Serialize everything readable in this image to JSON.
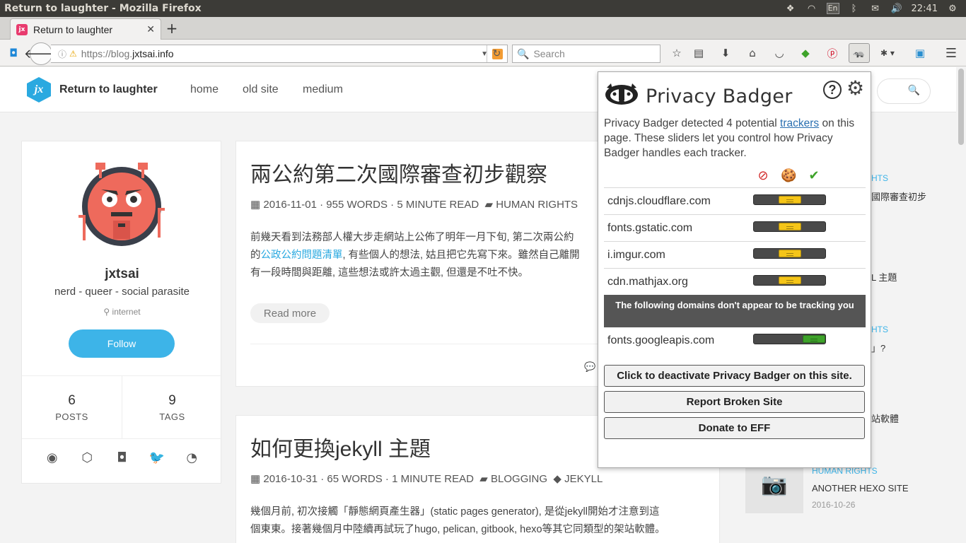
{
  "os": {
    "window_title": "Return to laughter - Mozilla Firefox",
    "input_method": "En",
    "clock": "22:41"
  },
  "browser": {
    "tab_title": "Return to laughter",
    "tab_favicon_text": "jx",
    "url_prefix": "https://blog.",
    "url_domain": "jxtsai.info",
    "search_placeholder": "Search"
  },
  "site": {
    "logo_text": "jx",
    "title": "Return to laughter",
    "nav": [
      "home",
      "old site",
      "medium"
    ]
  },
  "profile": {
    "name": "jxtsai",
    "bio": "nerd - queer - social parasite",
    "location": "internet",
    "follow_label": "Follow",
    "posts_count": "6",
    "posts_label": "POSTS",
    "tags_count": "9",
    "tags_label": "TAGS"
  },
  "posts": [
    {
      "title": "兩公約第二次國際審查初步觀察",
      "meta": "2016-11-01 · 955 WORDS · 5 MINUTE READ",
      "category": "HUMAN RIGHTS",
      "excerpt_1": "前幾天看到法務部人權大步走網站上公佈了明年一月下旬, 第二次兩公約",
      "excerpt_2a": "的",
      "excerpt_link": "公政公約問題清單",
      "excerpt_2b": ", 有些個人的想法, 姑且把它先寫下來。雖然自己離開",
      "excerpt_3": "有一段時間與距離, 這些想法或許太過主觀, 但還是不吐不快。",
      "read_more": "Read more"
    },
    {
      "title": "如何更換jekyll 主題",
      "meta": "2016-10-31 · 65 WORDS · 1 MINUTE READ",
      "category": "BLOGGING",
      "tag": "JEKYLL",
      "excerpt_1": "幾個月前, 初次接觸「靜態網頁產生器」(static pages generator), 是從jekyll開始才注意到這",
      "excerpt_2": "個東東。接著幾個月中陸續再試玩了hugo, pelican, gitbook, hexo等其它同類型的架站軟體。"
    }
  ],
  "sidebar": {
    "frag_cat1": "HTS",
    "frag_title1": "國際審查初步",
    "frag_title2": "L 主題",
    "frag_cat3": "HTS",
    "frag_title3": "」?",
    "frag_title4": "站軟體",
    "last_cat": "HUMAN RIGHTS",
    "last_title": "ANOTHER HEXO SITE",
    "last_date": "2016-10-26"
  },
  "privacy_badger": {
    "title": "Privacy Badger",
    "desc_pre": "Privacy Badger detected 4 potential ",
    "desc_link": "trackers",
    "desc_post": " on this page. These sliders let you control how Privacy Badger handles each tracker.",
    "trackers": [
      {
        "domain": "cdnjs.cloudflare.com",
        "state": "cookieblock"
      },
      {
        "domain": "fonts.gstatic.com",
        "state": "cookieblock"
      },
      {
        "domain": "i.imgur.com",
        "state": "cookieblock"
      },
      {
        "domain": "cdn.mathjax.org",
        "state": "cookieblock"
      }
    ],
    "non_tracking_note": "The following domains don't appear to be tracking you",
    "non_trackers": [
      {
        "domain": "fonts.googleapis.com",
        "state": "allow"
      }
    ],
    "btn_deactivate": "Click to deactivate Privacy Badger on this site.",
    "btn_report": "Report Broken Site",
    "btn_donate": "Donate to EFF",
    "colors": {
      "cookieblock": "#f5c518",
      "allow": "#3ea32a",
      "block": "#d22a2a"
    }
  }
}
